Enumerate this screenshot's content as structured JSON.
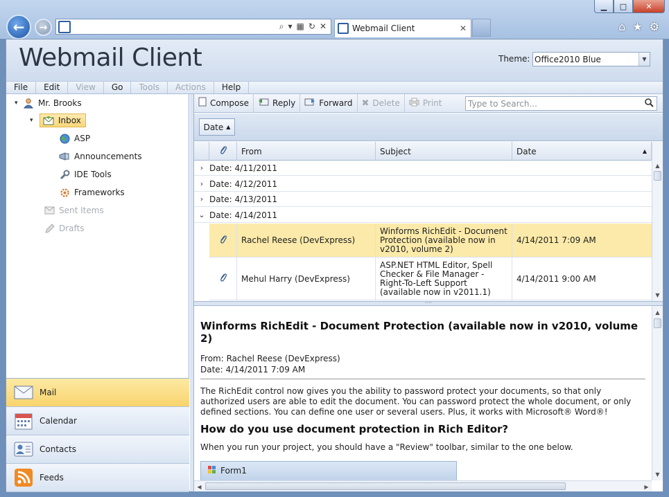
{
  "browser": {
    "tab_title": "Webmail Client",
    "address_value": ""
  },
  "header": {
    "app_title": "Webmail Client",
    "theme_label": "Theme:",
    "theme_value": "Office2010 Blue"
  },
  "menu": [
    {
      "label": "File",
      "enabled": true
    },
    {
      "label": "Edit",
      "enabled": true
    },
    {
      "label": "View",
      "enabled": false
    },
    {
      "label": "Go",
      "enabled": true
    },
    {
      "label": "Tools",
      "enabled": false
    },
    {
      "label": "Actions",
      "enabled": false
    },
    {
      "label": "Help",
      "enabled": true
    }
  ],
  "tree": {
    "user": "Mr. Brooks",
    "inbox": "Inbox",
    "folders": [
      "ASP",
      "Announcements",
      "IDE Tools",
      "Frameworks"
    ],
    "sent": "Sent Items",
    "drafts": "Drafts"
  },
  "navbar": [
    "Mail",
    "Calendar",
    "Contacts",
    "Feeds"
  ],
  "toolbar": {
    "compose": "Compose",
    "reply": "Reply",
    "forward": "Forward",
    "delete": "Delete",
    "print": "Print",
    "search_placeholder": "Type to Search..."
  },
  "groupby": {
    "chip": "Date"
  },
  "grid": {
    "headers": {
      "from": "From",
      "subject": "Subject",
      "date": "Date"
    },
    "groups": [
      {
        "label": "Date: 4/11/2011",
        "expanded": false
      },
      {
        "label": "Date: 4/12/2011",
        "expanded": false
      },
      {
        "label": "Date: 4/13/2011",
        "expanded": false
      },
      {
        "label": "Date: 4/14/2011",
        "expanded": true
      }
    ],
    "rows": [
      {
        "from": "Rachel Reese (DevExpress)",
        "subject": "Winforms RichEdit - Document Protection (available now in v2010, volume 2)",
        "date": "4/14/2011 7:09 AM"
      },
      {
        "from": "Mehul Harry (DevExpress)",
        "subject": "ASP.NET HTML Editor, Spell Checker & File Manager - Right-To-Left Support (available now in v2011.1)",
        "date": "4/14/2011 9:00 AM"
      }
    ]
  },
  "preview": {
    "title": "Winforms RichEdit - Document Protection (available now in v2010, volume 2)",
    "from": "From: Rachel Reese (DevExpress)",
    "date": "Date: 4/14/2011 7:09 AM",
    "body": "The RichEdit control now gives you the ability to password protect your documents, so that only authorized users are able to edit the document. You can password protect the whole document, or only defined sections. You can define one user or several users. Plus, it works with Microsoft® Word®!",
    "heading2": "How do you use document protection in Rich Editor?",
    "body2": "When you run your project, you should have a \"Review\" toolbar, similar to the one below.",
    "image_caption": "Form1"
  },
  "colors": {
    "accent": "#2d5ea3",
    "selection": "#fbeaa9",
    "chrome": "#a7c1e2"
  }
}
